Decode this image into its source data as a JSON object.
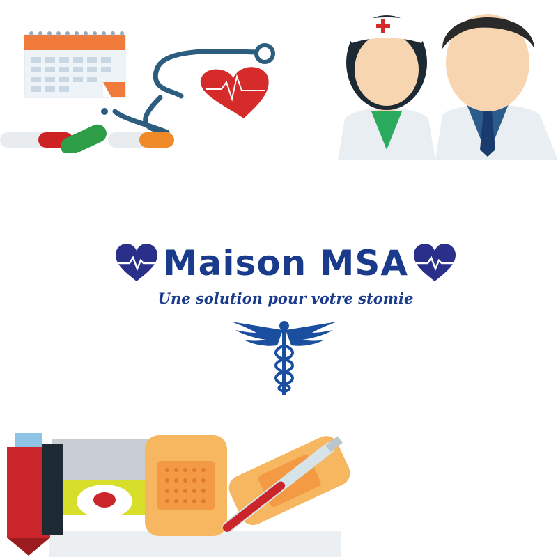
{
  "brand": {
    "title": "Maison MSA",
    "tagline": "Une solution pour votre stomie",
    "color": "#1a3b8c"
  },
  "icons": {
    "left_heart": "heart-pulse-icon",
    "right_heart": "heart-pulse-icon",
    "emblem": "caduceus-icon"
  },
  "illustrations": {
    "top_left": "medical-supplies-illustration",
    "top_right": "nurse-and-doctor-illustration",
    "bottom_left": "bandages-and-thermometer-illustration"
  }
}
